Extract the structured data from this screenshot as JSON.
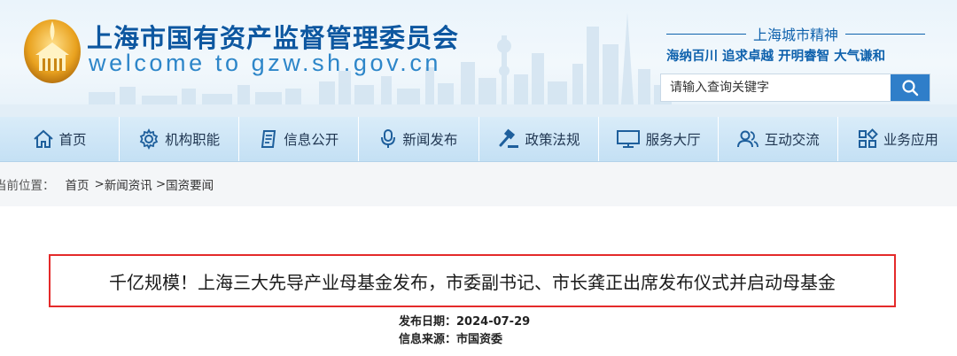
{
  "header": {
    "site_title": "上海市国有资产监督管理委员会",
    "site_url": "welcome to gzw.sh.gov.cn",
    "spirit_title": "上海城市精神",
    "spirit_motto": "海纳百川  追求卓越  开明睿智  大气谦和",
    "search_placeholder": "请输入查询关键字"
  },
  "nav": {
    "items": [
      {
        "label": "首页",
        "icon": "home-icon"
      },
      {
        "label": "机构职能",
        "icon": "gear-icon"
      },
      {
        "label": "信息公开",
        "icon": "document-icon"
      },
      {
        "label": "新闻发布",
        "icon": "microphone-icon"
      },
      {
        "label": "政策法规",
        "icon": "gavel-icon"
      },
      {
        "label": "服务大厅",
        "icon": "monitor-icon"
      },
      {
        "label": "互动交流",
        "icon": "users-icon"
      },
      {
        "label": "业务应用",
        "icon": "apps-icon"
      }
    ]
  },
  "breadcrumb": {
    "label": "当前位置：",
    "items": [
      "首页",
      "新闻资讯",
      "国资要闻"
    ],
    "separator": ">"
  },
  "article": {
    "title": "千亿规模！上海三大先导产业母基金发布，市委副书记、市长龚正出席发布仪式并启动母基金",
    "publish_date_label": "发布日期：",
    "publish_date": "2024-07-29",
    "source_label": "信息来源：",
    "source": "市国资委"
  },
  "colors": {
    "brand_blue": "#0d57a0",
    "nav_bg": "#c4e0f4",
    "search_button": "#2f7ec9",
    "title_border": "#e42a2a"
  }
}
